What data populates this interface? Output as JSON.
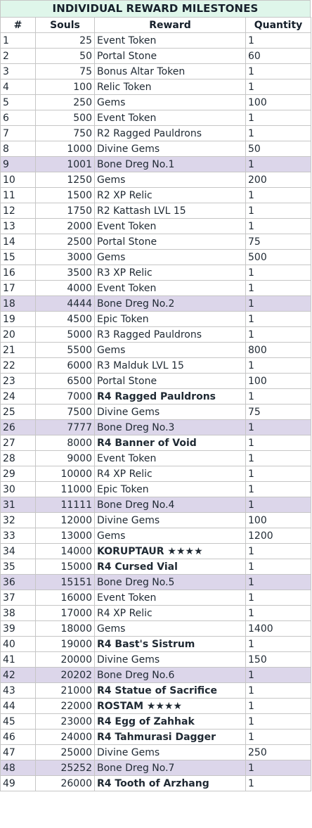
{
  "title": "INDIVIDUAL REWARD MILESTONES",
  "headers": [
    "#",
    "Souls",
    "Reward",
    "Quantity"
  ],
  "highlight_color": "#dcd6ea",
  "header_color": "#dff6ea",
  "rows": [
    {
      "n": "1",
      "souls": "25",
      "reward": "Event Token",
      "qty": "1",
      "hl": false,
      "bold": false
    },
    {
      "n": "2",
      "souls": "50",
      "reward": "Portal Stone",
      "qty": "60",
      "hl": false,
      "bold": false
    },
    {
      "n": "3",
      "souls": "75",
      "reward": "Bonus Altar Token",
      "qty": "1",
      "hl": false,
      "bold": false
    },
    {
      "n": "4",
      "souls": "100",
      "reward": "Relic Token",
      "qty": "1",
      "hl": false,
      "bold": false
    },
    {
      "n": "5",
      "souls": "250",
      "reward": "Gems",
      "qty": "100",
      "hl": false,
      "bold": false
    },
    {
      "n": "6",
      "souls": "500",
      "reward": "Event Token",
      "qty": "1",
      "hl": false,
      "bold": false
    },
    {
      "n": "7",
      "souls": "750",
      "reward": "R2 Ragged Pauldrons",
      "qty": "1",
      "hl": false,
      "bold": false
    },
    {
      "n": "8",
      "souls": "1000",
      "reward": "Divine Gems",
      "qty": "50",
      "hl": false,
      "bold": false
    },
    {
      "n": "9",
      "souls": "1001",
      "reward": "Bone Dreg No.1",
      "qty": "1",
      "hl": true,
      "bold": false
    },
    {
      "n": "10",
      "souls": "1250",
      "reward": "Gems",
      "qty": "200",
      "hl": false,
      "bold": false
    },
    {
      "n": "11",
      "souls": "1500",
      "reward": "R2 XP Relic",
      "qty": "1",
      "hl": false,
      "bold": false
    },
    {
      "n": "12",
      "souls": "1750",
      "reward": "R2 Kattash LVL 15",
      "qty": "1",
      "hl": false,
      "bold": false
    },
    {
      "n": "13",
      "souls": "2000",
      "reward": "Event Token",
      "qty": "1",
      "hl": false,
      "bold": false
    },
    {
      "n": "14",
      "souls": "2500",
      "reward": "Portal Stone",
      "qty": "75",
      "hl": false,
      "bold": false
    },
    {
      "n": "15",
      "souls": "3000",
      "reward": "Gems",
      "qty": "500",
      "hl": false,
      "bold": false
    },
    {
      "n": "16",
      "souls": "3500",
      "reward": "R3 XP Relic",
      "qty": "1",
      "hl": false,
      "bold": false
    },
    {
      "n": "17",
      "souls": "4000",
      "reward": "Event Token",
      "qty": "1",
      "hl": false,
      "bold": false
    },
    {
      "n": "18",
      "souls": "4444",
      "reward": "Bone Dreg No.2",
      "qty": "1",
      "hl": true,
      "bold": false
    },
    {
      "n": "19",
      "souls": "4500",
      "reward": "Epic Token",
      "qty": "1",
      "hl": false,
      "bold": false
    },
    {
      "n": "20",
      "souls": "5000",
      "reward": "R3 Ragged Pauldrons",
      "qty": "1",
      "hl": false,
      "bold": false
    },
    {
      "n": "21",
      "souls": "5500",
      "reward": "Gems",
      "qty": "800",
      "hl": false,
      "bold": false
    },
    {
      "n": "22",
      "souls": "6000",
      "reward": "R3 Malduk LVL 15",
      "qty": "1",
      "hl": false,
      "bold": false
    },
    {
      "n": "23",
      "souls": "6500",
      "reward": "Portal Stone",
      "qty": "100",
      "hl": false,
      "bold": false
    },
    {
      "n": "24",
      "souls": "7000",
      "reward": "R4 Ragged Pauldrons",
      "qty": "1",
      "hl": false,
      "bold": true
    },
    {
      "n": "25",
      "souls": "7500",
      "reward": "Divine Gems",
      "qty": "75",
      "hl": false,
      "bold": false
    },
    {
      "n": "26",
      "souls": "7777",
      "reward": "Bone Dreg No.3",
      "qty": "1",
      "hl": true,
      "bold": false
    },
    {
      "n": "27",
      "souls": "8000",
      "reward": "R4 Banner of Void",
      "qty": "1",
      "hl": false,
      "bold": true
    },
    {
      "n": "28",
      "souls": "9000",
      "reward": "Event Token",
      "qty": "1",
      "hl": false,
      "bold": false
    },
    {
      "n": "29",
      "souls": "10000",
      "reward": "R4 XP Relic",
      "qty": "1",
      "hl": false,
      "bold": false
    },
    {
      "n": "30",
      "souls": "11000",
      "reward": "Epic Token",
      "qty": "1",
      "hl": false,
      "bold": false
    },
    {
      "n": "31",
      "souls": "11111",
      "reward": "Bone Dreg No.4",
      "qty": "1",
      "hl": true,
      "bold": false
    },
    {
      "n": "32",
      "souls": "12000",
      "reward": "Divine Gems",
      "qty": "100",
      "hl": false,
      "bold": false
    },
    {
      "n": "33",
      "souls": "13000",
      "reward": "Gems",
      "qty": "1200",
      "hl": false,
      "bold": false
    },
    {
      "n": "34",
      "souls": "14000",
      "reward": "KORUPTAUR ★★★★",
      "qty": "1",
      "hl": false,
      "bold": true
    },
    {
      "n": "35",
      "souls": "15000",
      "reward": "R4 Cursed Vial",
      "qty": "1",
      "hl": false,
      "bold": true
    },
    {
      "n": "36",
      "souls": "15151",
      "reward": "Bone Dreg No.5",
      "qty": "1",
      "hl": true,
      "bold": false
    },
    {
      "n": "37",
      "souls": "16000",
      "reward": "Event Token",
      "qty": "1",
      "hl": false,
      "bold": false
    },
    {
      "n": "38",
      "souls": "17000",
      "reward": "R4 XP Relic",
      "qty": "1",
      "hl": false,
      "bold": false
    },
    {
      "n": "39",
      "souls": "18000",
      "reward": "Gems",
      "qty": "1400",
      "hl": false,
      "bold": false
    },
    {
      "n": "40",
      "souls": "19000",
      "reward": "R4 Bast's Sistrum",
      "qty": "1",
      "hl": false,
      "bold": true
    },
    {
      "n": "41",
      "souls": "20000",
      "reward": "Divine Gems",
      "qty": "150",
      "hl": false,
      "bold": false
    },
    {
      "n": "42",
      "souls": "20202",
      "reward": "Bone Dreg No.6",
      "qty": "1",
      "hl": true,
      "bold": false
    },
    {
      "n": "43",
      "souls": "21000",
      "reward": "R4 Statue of Sacrifice",
      "qty": "1",
      "hl": false,
      "bold": true
    },
    {
      "n": "44",
      "souls": "22000",
      "reward": "ROSTAM ★★★★",
      "qty": "1",
      "hl": false,
      "bold": true
    },
    {
      "n": "45",
      "souls": "23000",
      "reward": "R4 Egg of Zahhak",
      "qty": "1",
      "hl": false,
      "bold": true
    },
    {
      "n": "46",
      "souls": "24000",
      "reward": "R4 Tahmurasi Dagger",
      "qty": "1",
      "hl": false,
      "bold": true
    },
    {
      "n": "47",
      "souls": "25000",
      "reward": "Divine Gems",
      "qty": "250",
      "hl": false,
      "bold": false
    },
    {
      "n": "48",
      "souls": "25252",
      "reward": "Bone Dreg No.7",
      "qty": "1",
      "hl": true,
      "bold": false
    },
    {
      "n": "49",
      "souls": "26000",
      "reward": "R4 Tooth of Arzhang",
      "qty": "1",
      "hl": false,
      "bold": true
    }
  ]
}
